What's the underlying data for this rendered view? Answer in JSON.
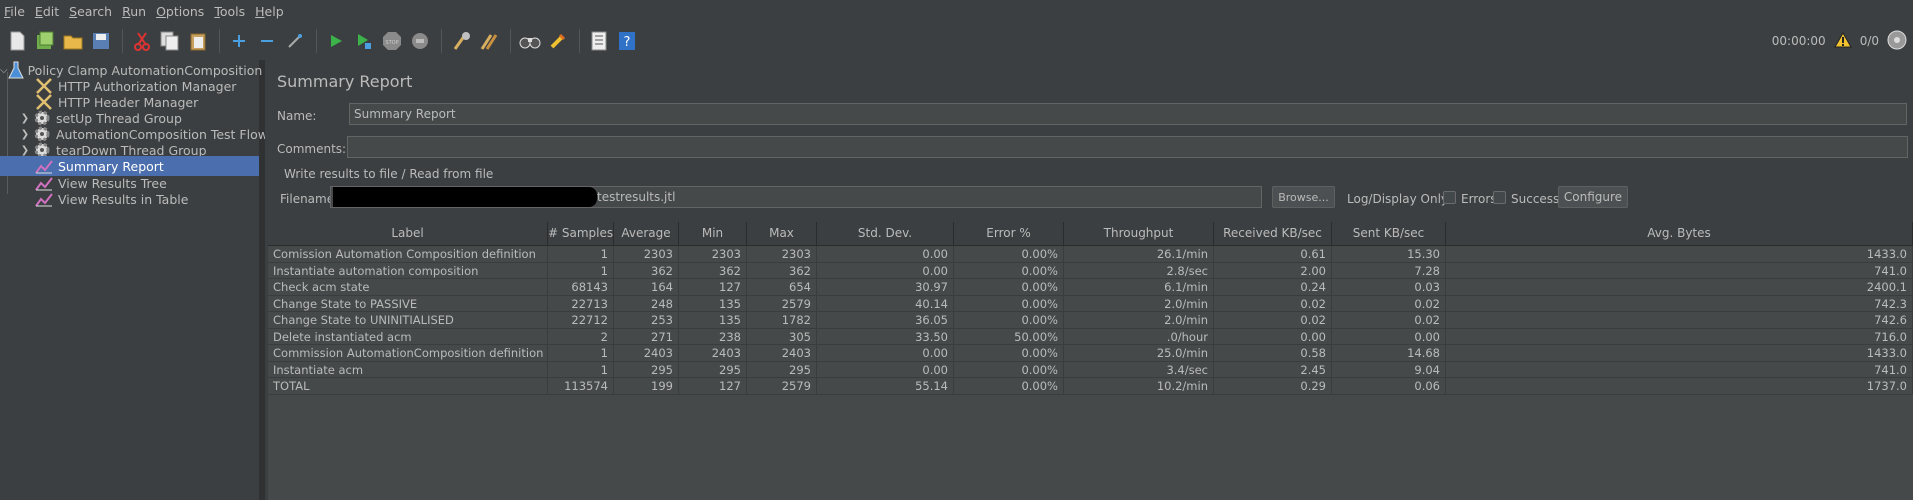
{
  "menu": [
    {
      "label": "File",
      "mnemonic": "F",
      "rest": "ile"
    },
    {
      "label": "Edit",
      "mnemonic": "E",
      "rest": "dit"
    },
    {
      "label": "Search",
      "mnemonic": "S",
      "rest": "earch"
    },
    {
      "label": "Run",
      "mnemonic": "R",
      "rest": "un"
    },
    {
      "label": "Options",
      "mnemonic": "O",
      "rest": "ptions"
    },
    {
      "label": "Tools",
      "mnemonic": "T",
      "rest": "ools"
    },
    {
      "label": "Help",
      "mnemonic": "H",
      "rest": "elp"
    }
  ],
  "toolbar": {
    "elapsed_time": "00:00:00",
    "thread_count": "0/0"
  },
  "tree": {
    "root": "Policy Clamp AutomationComposition P",
    "items": [
      {
        "label": "HTTP Authorization Manager",
        "icon": "wrench-scissors-icon"
      },
      {
        "label": "HTTP Header Manager",
        "icon": "wrench-scissors-icon"
      },
      {
        "label": "setUp Thread Group",
        "icon": "gear-icon"
      },
      {
        "label": "AutomationComposition Test Flow",
        "icon": "gear-icon"
      },
      {
        "label": "tearDown Thread Group",
        "icon": "gear-icon"
      },
      {
        "label": "Summary Report",
        "icon": "chart-icon"
      },
      {
        "label": "View Results Tree",
        "icon": "chart-icon"
      },
      {
        "label": "View Results in Table",
        "icon": "chart-icon"
      }
    ]
  },
  "panel": {
    "title": "Summary Report",
    "name_label": "Name:",
    "name_value": "Summary Report",
    "comments_label": "Comments:",
    "comments_value": "",
    "write_results_label": "Write results to file / Read from file",
    "filename_label": "Filename",
    "filename_value": "testresults.jtl",
    "browse_label": "Browse...",
    "log_display_label": "Log/Display Only:",
    "errors_label": "Errors",
    "successes_label": "Successes",
    "configure_label": "Configure"
  },
  "table": {
    "columns": [
      "Label",
      "# Samples",
      "Average",
      "Min",
      "Max",
      "Std. Dev.",
      "Error %",
      "Throughput",
      "Received KB/sec",
      "Sent KB/sec",
      "Avg. Bytes"
    ],
    "rows": [
      [
        "Comission Automation Composition definition",
        "1",
        "2303",
        "2303",
        "2303",
        "0.00",
        "0.00%",
        "26.1/min",
        "0.61",
        "15.30",
        "1433.0"
      ],
      [
        "Instantiate automation composition",
        "1",
        "362",
        "362",
        "362",
        "0.00",
        "0.00%",
        "2.8/sec",
        "2.00",
        "7.28",
        "741.0"
      ],
      [
        "Check acm state",
        "68143",
        "164",
        "127",
        "654",
        "30.97",
        "0.00%",
        "6.1/min",
        "0.24",
        "0.03",
        "2400.1"
      ],
      [
        "Change State to PASSIVE",
        "22713",
        "248",
        "135",
        "2579",
        "40.14",
        "0.00%",
        "2.0/min",
        "0.02",
        "0.02",
        "742.3"
      ],
      [
        "Change State to UNINITIALISED",
        "22712",
        "253",
        "135",
        "1782",
        "36.05",
        "0.00%",
        "2.0/min",
        "0.02",
        "0.02",
        "742.6"
      ],
      [
        "Delete instantiated acm",
        "2",
        "271",
        "238",
        "305",
        "33.50",
        "50.00%",
        ".0/hour",
        "0.00",
        "0.00",
        "716.0"
      ],
      [
        "Commission AutomationComposition definition",
        "1",
        "2403",
        "2403",
        "2403",
        "0.00",
        "0.00%",
        "25.0/min",
        "0.58",
        "14.68",
        "1433.0"
      ],
      [
        "Instantiate acm",
        "1",
        "295",
        "295",
        "295",
        "0.00",
        "0.00%",
        "3.4/sec",
        "2.45",
        "9.04",
        "741.0"
      ],
      [
        "TOTAL",
        "113574",
        "199",
        "127",
        "2579",
        "55.14",
        "0.00%",
        "10.2/min",
        "0.29",
        "0.06",
        "1737.0"
      ]
    ]
  }
}
